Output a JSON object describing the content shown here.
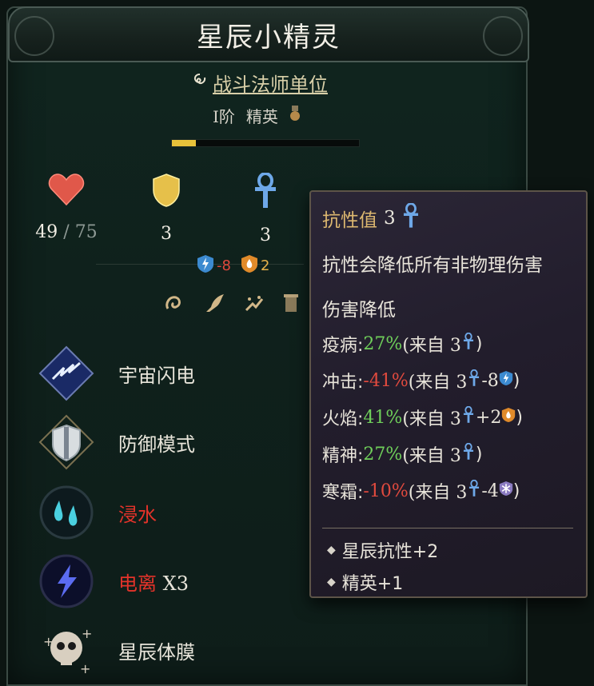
{
  "title": "星辰小精灵",
  "unit_type": "战斗法师单位",
  "rank": {
    "tier": "I阶",
    "class": "精英"
  },
  "xp_progress": 0.13,
  "stats": {
    "health": {
      "current": "49",
      "separator": "/",
      "max": "75",
      "icon": "heart-icon"
    },
    "armor": {
      "value": "3",
      "icon": "shield-icon"
    },
    "resistance": {
      "value": "3",
      "icon": "ankh-icon"
    }
  },
  "modifiers": [
    {
      "icon": "lightning-shield-icon",
      "value": "-8",
      "color": "#e0483c"
    },
    {
      "icon": "fire-shield-icon",
      "value": "2",
      "color": "#e6b24a"
    }
  ],
  "abilities": [
    {
      "name": "宇宙闪电",
      "icon": "cosmic-lightning-icon",
      "status": false
    },
    {
      "name": "防御模式",
      "icon": "defense-mode-icon",
      "status": false
    },
    {
      "name": "浸水",
      "icon": "water-drops-icon",
      "status": true
    },
    {
      "name": "电离",
      "mult": "X3",
      "icon": "ionized-icon",
      "status": true
    },
    {
      "name": "星辰体膜",
      "icon": "skull-plus-icon",
      "status": false
    }
  ],
  "tooltip": {
    "title": "抗性值",
    "value": "3",
    "description": "抗性会降低所有非物理伤害",
    "subheader": "伤害降低",
    "rows": [
      {
        "label": "疫病:",
        "percent": "27%",
        "sign": "pos",
        "source": "(来自 3",
        "extra": "",
        "close": ")"
      },
      {
        "label": "冲击:",
        "percent": "-41%",
        "sign": "neg",
        "source": "(来自 3",
        "extra": "-8",
        "extra_icon": "lightning-shield-icon",
        "close": ")"
      },
      {
        "label": "火焰:",
        "percent": "41%",
        "sign": "pos",
        "source": "(来自 3",
        "extra": "+2",
        "extra_icon": "fire-shield-icon",
        "close": ")"
      },
      {
        "label": "精神:",
        "percent": "27%",
        "sign": "pos",
        "source": "(来自 3",
        "extra": "",
        "close": ")"
      },
      {
        "label": "寒霜:",
        "percent": "-10%",
        "sign": "neg",
        "source": "(来自 3",
        "extra": "-4",
        "extra_icon": "frost-shield-icon",
        "close": ")"
      }
    ],
    "bullets": [
      "星辰抗性+2",
      "精英+1"
    ]
  },
  "colors": {
    "accent_gold": "#ddb870",
    "positive": "#6fcf5a",
    "negative": "#e04a3e",
    "xp_fill": "#e8c23a",
    "ankh_blue": "#6ea8e8"
  }
}
